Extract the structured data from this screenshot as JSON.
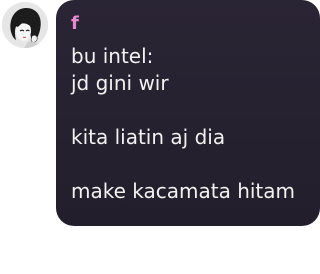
{
  "chat": {
    "sender_name": "f",
    "message_text": "bu intel:\njd gini wir\n\nkita liatin aj dia\n\nmake kacamata hitam"
  },
  "icons": {
    "avatar": "girl-sketch-avatar"
  },
  "colors": {
    "bubble": "#262130",
    "sender_name": "#e68ad2",
    "message_text": "#f2f2f2",
    "background": "#ffffff"
  }
}
